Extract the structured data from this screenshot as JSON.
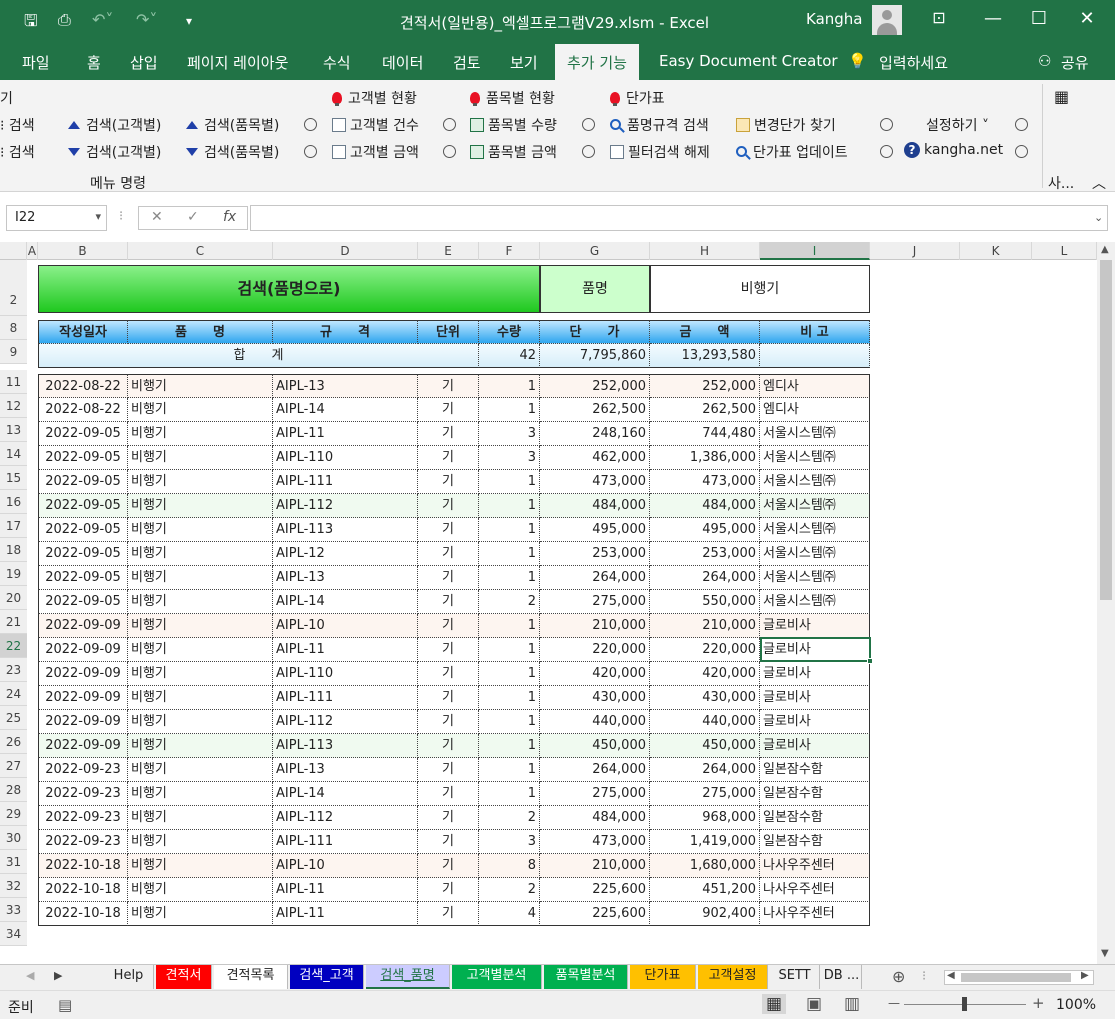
{
  "window": {
    "title": "견적서(일반용)_엑셀프로그램V29.xlsm  -  Excel",
    "user": "Kangha",
    "minimize": "—",
    "restore": "☐",
    "close": "✕"
  },
  "ribbon_tabs": [
    {
      "label": "파일"
    },
    {
      "label": "홈"
    },
    {
      "label": "삽입"
    },
    {
      "label": "페이지 레이아웃"
    },
    {
      "label": "수식"
    },
    {
      "label": "데이터"
    },
    {
      "label": "검토"
    },
    {
      "label": "보기"
    },
    {
      "label": "추가 기능"
    },
    {
      "label": "Easy Document Creator"
    },
    {
      "label": "입력하세요"
    },
    {
      "label": "공유"
    }
  ],
  "ribbon": {
    "cut_left_top": "기",
    "cut_left_r1": "검색",
    "cut_left_r2": "검색",
    "asc_customer": "검색(고객별)",
    "asc_item": "검색(품목별)",
    "desc_customer": "검색(고객별)",
    "desc_item": "검색(품목별)",
    "customer_status": "고객별 현황",
    "item_status": "품목별 현황",
    "price_table": "단가표",
    "customer_count": "고객별 건수",
    "customer_amount": "고객별 금액",
    "item_qty": "품목별 수량",
    "item_amount": "품목별 금액",
    "spec_search": "품명규격 검색",
    "filter_clear": "필터검색 해제",
    "changed_price": "변경단가 찾기",
    "price_update": "단가표 업데이트",
    "settings": "설정하기 ˅",
    "site": "kangha.net",
    "group_label": "메뉴 명령",
    "right_group": "사..."
  },
  "formula_bar": {
    "name_box": "I22",
    "fx": "fx",
    "cancel": "✕",
    "enter": "✓",
    "value": ""
  },
  "columns": [
    "A",
    "B",
    "C",
    "D",
    "E",
    "F",
    "G",
    "H",
    "I",
    "J",
    "K",
    "L"
  ],
  "row_numbers": [
    "2",
    "8",
    "9",
    "11",
    "12",
    "13",
    "14",
    "15",
    "16",
    "17",
    "18",
    "19",
    "20",
    "21",
    "22",
    "23",
    "24",
    "25",
    "26",
    "27",
    "28",
    "29",
    "30",
    "31",
    "32",
    "33",
    "34"
  ],
  "sheet": {
    "banner": "검색(품명으로)",
    "filter_label": "품명",
    "filter_value": "비행기",
    "headers": [
      "작성일자",
      "품　　명",
      "규　　격",
      "단위",
      "수량",
      "단　　가",
      "금　　액",
      "비 고"
    ],
    "total_label": "합　　계",
    "total_qty": "42",
    "total_price": "7,795,860",
    "total_amount": "13,293,580",
    "rows": [
      [
        "2022-08-22",
        "비행기",
        "AIPL-13",
        "기",
        "1",
        "252,000",
        "252,000",
        "엠디사"
      ],
      [
        "2022-08-22",
        "비행기",
        "AIPL-14",
        "기",
        "1",
        "262,500",
        "262,500",
        "엠디사"
      ],
      [
        "2022-09-05",
        "비행기",
        "AIPL-11",
        "기",
        "3",
        "248,160",
        "744,480",
        "서울시스템㈜"
      ],
      [
        "2022-09-05",
        "비행기",
        "AIPL-110",
        "기",
        "3",
        "462,000",
        "1,386,000",
        "서울시스템㈜"
      ],
      [
        "2022-09-05",
        "비행기",
        "AIPL-111",
        "기",
        "1",
        "473,000",
        "473,000",
        "서울시스템㈜"
      ],
      [
        "2022-09-05",
        "비행기",
        "AIPL-112",
        "기",
        "1",
        "484,000",
        "484,000",
        "서울시스템㈜"
      ],
      [
        "2022-09-05",
        "비행기",
        "AIPL-113",
        "기",
        "1",
        "495,000",
        "495,000",
        "서울시스템㈜"
      ],
      [
        "2022-09-05",
        "비행기",
        "AIPL-12",
        "기",
        "1",
        "253,000",
        "253,000",
        "서울시스템㈜"
      ],
      [
        "2022-09-05",
        "비행기",
        "AIPL-13",
        "기",
        "1",
        "264,000",
        "264,000",
        "서울시스템㈜"
      ],
      [
        "2022-09-05",
        "비행기",
        "AIPL-14",
        "기",
        "2",
        "275,000",
        "550,000",
        "서울시스템㈜"
      ],
      [
        "2022-09-09",
        "비행기",
        "AIPL-10",
        "기",
        "1",
        "210,000",
        "210,000",
        "글로비사"
      ],
      [
        "2022-09-09",
        "비행기",
        "AIPL-11",
        "기",
        "1",
        "220,000",
        "220,000",
        "글로비사"
      ],
      [
        "2022-09-09",
        "비행기",
        "AIPL-110",
        "기",
        "1",
        "420,000",
        "420,000",
        "글로비사"
      ],
      [
        "2022-09-09",
        "비행기",
        "AIPL-111",
        "기",
        "1",
        "430,000",
        "430,000",
        "글로비사"
      ],
      [
        "2022-09-09",
        "비행기",
        "AIPL-112",
        "기",
        "1",
        "440,000",
        "440,000",
        "글로비사"
      ],
      [
        "2022-09-09",
        "비행기",
        "AIPL-113",
        "기",
        "1",
        "450,000",
        "450,000",
        "글로비사"
      ],
      [
        "2022-09-23",
        "비행기",
        "AIPL-13",
        "기",
        "1",
        "264,000",
        "264,000",
        "일본잠수함"
      ],
      [
        "2022-09-23",
        "비행기",
        "AIPL-14",
        "기",
        "1",
        "275,000",
        "275,000",
        "일본잠수함"
      ],
      [
        "2022-09-23",
        "비행기",
        "AIPL-112",
        "기",
        "2",
        "484,000",
        "968,000",
        "일본잠수함"
      ],
      [
        "2022-09-23",
        "비행기",
        "AIPL-111",
        "기",
        "3",
        "473,000",
        "1,419,000",
        "일본잠수함"
      ],
      [
        "2022-10-18",
        "비행기",
        "AIPL-10",
        "기",
        "8",
        "210,000",
        "1,680,000",
        "나사우주센터"
      ],
      [
        "2022-10-18",
        "비행기",
        "AIPL-11",
        "기",
        "2",
        "225,600",
        "451,200",
        "나사우주센터"
      ],
      [
        "2022-10-18",
        "비행기",
        "AIPL-11",
        "기",
        "4",
        "225,600",
        "902,400",
        "나사우주센터"
      ]
    ]
  },
  "sheet_tabs": [
    {
      "label": "Help",
      "bg": "#f0f0f0",
      "fg": "#222"
    },
    {
      "label": "견적서",
      "bg": "#ff0000",
      "fg": "#fff"
    },
    {
      "label": "견적목록",
      "bg": "#ffffff",
      "fg": "#222"
    },
    {
      "label": "검색_고객",
      "bg": "#0000c0",
      "fg": "#fff"
    },
    {
      "label": "검색_품명",
      "bg": "#ccccff",
      "fg": "#217346"
    },
    {
      "label": "고객별분석",
      "bg": "#00b050",
      "fg": "#fff"
    },
    {
      "label": "품목별분석",
      "bg": "#00b050",
      "fg": "#fff"
    },
    {
      "label": "단가표",
      "bg": "#ffc000",
      "fg": "#222"
    },
    {
      "label": "고객설정",
      "bg": "#ffc000",
      "fg": "#222"
    },
    {
      "label": "SETT",
      "bg": "#f0f0f0",
      "fg": "#222"
    },
    {
      "label": "DB ...",
      "bg": "#f0f0f0",
      "fg": "#222"
    }
  ],
  "status": {
    "ready": "준비",
    "zoom": "100%",
    "minus": "—",
    "plus": "+"
  },
  "colors": {
    "excel_green": "#217346",
    "banner_green": "#33cc33",
    "header_blue": "#3ab0f0",
    "selection": "#217346"
  }
}
